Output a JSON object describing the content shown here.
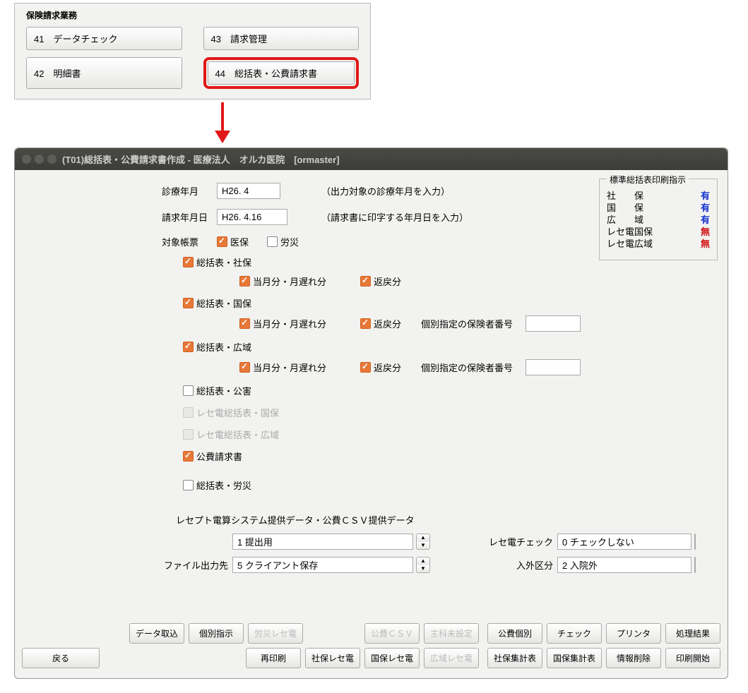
{
  "topPanel": {
    "title": "保険請求業務",
    "buttons": [
      {
        "label": "41　データチェック"
      },
      {
        "label": "43　請求管理"
      },
      {
        "label": "42　明細書"
      },
      {
        "label": "44　総括表・公費請求書"
      }
    ]
  },
  "window": {
    "title": "(T01)総括表・公費請求書作成 - 医療法人　オルカ医院　[ormaster]"
  },
  "printPanel": {
    "title": "標準総括表印刷指示",
    "rows": [
      {
        "label": "社　　保",
        "value": "有",
        "cls": "blue"
      },
      {
        "label": "国　　保",
        "value": "有",
        "cls": "blue"
      },
      {
        "label": "広　　域",
        "value": "有",
        "cls": "blue"
      },
      {
        "label": "レセ電国保",
        "value": "無",
        "cls": "red"
      },
      {
        "label": "レセ電広域",
        "value": "無",
        "cls": "red"
      }
    ]
  },
  "form": {
    "ymLabel": "診療年月",
    "ymValue": "H26. 4",
    "ymHint": "（出力対象の診療年月を入力）",
    "dateLabel": "請求年月日",
    "dateValue": "H26. 4.16",
    "dateHint": "（請求書に印字する年月日を入力）",
    "targetLabel": "対象帳票",
    "ihoLabel": "医保",
    "rousaiLabel": "労災",
    "groups": {
      "shaho": {
        "label": "総括表・社保",
        "subMonth": "当月分・月遅れ分",
        "henrei": "返戻分"
      },
      "kokuho": {
        "label": "総括表・国保",
        "subMonth": "当月分・月遅れ分",
        "henrei": "返戻分",
        "kobetsu": "個別指定の保険者番号"
      },
      "kouiki": {
        "label": "総括表・広域",
        "subMonth": "当月分・月遅れ分",
        "henrei": "返戻分",
        "kobetsu": "個別指定の保険者番号"
      },
      "kougai": {
        "label": "総括表・公害"
      },
      "receKokuho": {
        "label": "レセ電総括表・国保"
      },
      "receKouiki": {
        "label": "レセ電総括表・広域"
      },
      "kouhi": {
        "label": "公費請求書"
      },
      "rousai": {
        "label": "総括表・労災"
      }
    }
  },
  "rece": {
    "title": "レセプト電算システム提供データ・公費ＣＳＶ提供データ",
    "submitValue": "1 提出用",
    "fileLabel": "ファイル出力先",
    "fileValue": "5 クライアント保存",
    "checkLabel": "レセ電チェック",
    "checkValue": "0 チェックしない",
    "nyugaiLabel": "入外区分",
    "nyugaiValue": "2 入院外"
  },
  "buttons": {
    "row1": [
      "データ取込",
      "個別指示",
      "労災レセ電",
      "公費ＣＳＶ",
      "主科未設定",
      "公費個別",
      "チェック",
      "プリンタ",
      "処理結果"
    ],
    "row2": [
      "戻る",
      "再印刷",
      "社保レセ電",
      "国保レセ電",
      "広域レセ電",
      "社保集計表",
      "国保集計表",
      "情報削除",
      "印刷開始"
    ]
  }
}
